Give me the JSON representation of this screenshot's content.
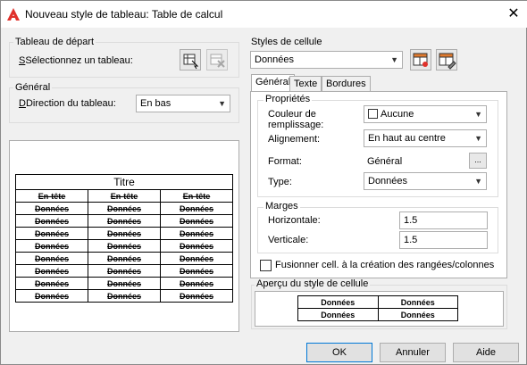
{
  "window": {
    "title": "Nouveau style de tableau: Table de calcul"
  },
  "starting_table": {
    "legend": "Tableau de départ",
    "select_label": "Sélectionnez un tableau:"
  },
  "general": {
    "legend": "Général",
    "direction_label": "Direction du tableau:",
    "direction_value": "En bas"
  },
  "table_preview": {
    "title": "Titre",
    "headers": [
      "En-tête",
      "En-tête",
      "En-tête"
    ],
    "rows": [
      [
        "Données",
        "Données",
        "Données"
      ],
      [
        "Données",
        "Données",
        "Données"
      ],
      [
        "Données",
        "Données",
        "Données"
      ],
      [
        "Données",
        "Données",
        "Données"
      ],
      [
        "Données",
        "Données",
        "Données"
      ],
      [
        "Données",
        "Données",
        "Données"
      ],
      [
        "Données",
        "Données",
        "Données"
      ],
      [
        "Données",
        "Données",
        "Données"
      ]
    ]
  },
  "cell_styles": {
    "legend": "Styles de cellule",
    "selected": "Données"
  },
  "tabs": {
    "general": "Général",
    "text": "Texte",
    "borders": "Bordures"
  },
  "properties": {
    "legend": "Propriétés",
    "fill_color_label": "Couleur de remplissage:",
    "fill_color_value": "Aucune",
    "alignment_label": "Alignement:",
    "alignment_value": "En haut au centre",
    "format_label": "Format:",
    "format_value": "Général",
    "format_button": "...",
    "type_label": "Type:",
    "type_value": "Données"
  },
  "margins": {
    "legend": "Marges",
    "horizontal_label": "Horizontale:",
    "horizontal_value": "1.5",
    "vertical_label": "Verticale:",
    "vertical_value": "1.5"
  },
  "merge_checkbox_label": "Fusionner cell. à la création des rangées/colonnes",
  "cell_preview": {
    "legend": "Aperçu du style de cellule",
    "cells": [
      [
        "Données",
        "Données"
      ],
      [
        "Données",
        "Données"
      ]
    ]
  },
  "buttons": {
    "ok": "OK",
    "cancel": "Annuler",
    "help": "Aide"
  },
  "colors": {
    "logo_red": "#e0312b",
    "dialog_bg": "#f0f0f0",
    "focus_blue": "#0078d7"
  }
}
